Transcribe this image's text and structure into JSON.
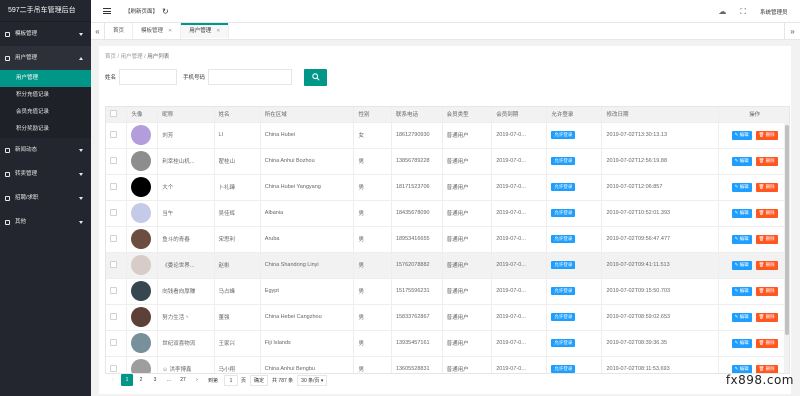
{
  "app": {
    "title": "597二手吊车管理后台",
    "refresh_label": "【刷新页面】",
    "system_label": "系统管理员"
  },
  "sidebar": {
    "groups": [
      {
        "label": "模板管理",
        "open": false,
        "items": []
      },
      {
        "label": "用户管理",
        "open": true,
        "items": [
          {
            "label": "用户管理",
            "active": true
          },
          {
            "label": "积分充值记录",
            "active": false
          },
          {
            "label": "会员充值记录",
            "active": false
          },
          {
            "label": "积分奖励记录",
            "active": false
          }
        ]
      },
      {
        "label": "新闻动态",
        "open": false,
        "items": []
      },
      {
        "label": "转卖管理",
        "open": false,
        "items": []
      },
      {
        "label": "招聘/求职",
        "open": false,
        "items": []
      },
      {
        "label": "其他",
        "open": false,
        "items": []
      }
    ]
  },
  "tabs": [
    {
      "label": "首页",
      "active": false,
      "closable": false
    },
    {
      "label": "模板管理",
      "active": false,
      "closable": true
    },
    {
      "label": "用户管理",
      "active": true,
      "closable": true
    }
  ],
  "breadcrumb": [
    "首页",
    "用户管理",
    "用户列表"
  ],
  "search": {
    "name_label": "姓名",
    "name_value": "",
    "phone_label": "手机号码",
    "phone_value": ""
  },
  "table": {
    "columns": [
      "头像",
      "昵称",
      "姓名",
      "所在区域",
      "性别",
      "联系电话",
      "会员类型",
      "会员到期",
      "允许登录",
      "修改日期",
      "操作"
    ],
    "rows": [
      {
        "avatar": "#b39ddb",
        "nickname": "刘芳",
        "name": "LI",
        "region": "China Hubei",
        "gender": "女",
        "phone": "18612790930",
        "type": "普通用户",
        "expiry": "2019-07-0...",
        "login": "允许登录",
        "modified": "2019-07-02T13:30:13.13",
        "highlight": false
      },
      {
        "avatar": "#8d8d8d",
        "nickname": "利幸桂山机...",
        "name": "翟桂山",
        "region": "China Anhui Bozhou",
        "gender": "男",
        "phone": "13856789228",
        "type": "普通用户",
        "expiry": "2019-07-0...",
        "login": "允许登录",
        "modified": "2019-07-02T12:56:19.88",
        "highlight": false
      },
      {
        "avatar": "#000000",
        "nickname": "大个",
        "name": "卜礼臻",
        "region": "China Hubei Yangyang",
        "gender": "男",
        "phone": "18171523706",
        "type": "普通用户",
        "expiry": "2019-07-0...",
        "login": "允许登录",
        "modified": "2019-07-02T12:06:857",
        "highlight": false
      },
      {
        "avatar": "#c5cae9",
        "nickname": "当午",
        "name": "吴佳辉",
        "region": "Albania",
        "gender": "男",
        "phone": "18435678090",
        "type": "普通用户",
        "expiry": "2019-07-0...",
        "login": "允许登录",
        "modified": "2019-07-02T10:52:01.393",
        "highlight": false
      },
      {
        "avatar": "#6d4c41",
        "nickname": "鱼斗的青春",
        "name": "宋思利",
        "region": "Aruba",
        "gender": "男",
        "phone": "18953416655",
        "type": "普通用户",
        "expiry": "2019-07-0...",
        "login": "允许登录",
        "modified": "2019-07-02T09:56:47.477",
        "highlight": false
      },
      {
        "avatar": "#d7ccc8",
        "nickname": "《委论世界...",
        "name": "赵彬",
        "region": "China Shandong Linyi",
        "gender": "男",
        "phone": "15762078882",
        "type": "普通用户",
        "expiry": "2019-07-0...",
        "login": "允许登录",
        "modified": "2019-07-02T09:41:11.513",
        "highlight": true
      },
      {
        "avatar": "#37474f",
        "nickname": "向钱看向厚赚",
        "name": "马占峰",
        "region": "Egypt",
        "gender": "男",
        "phone": "15175596231",
        "type": "普通用户",
        "expiry": "2019-07-0...",
        "login": "允许登录",
        "modified": "2019-07-02T09:15:50.703",
        "highlight": false
      },
      {
        "avatar": "#5d4037",
        "nickname": "努力生活丶",
        "name": "董强",
        "region": "China Hebei Cangzhou",
        "gender": "男",
        "phone": "15833762867",
        "type": "普通用户",
        "expiry": "2019-07-0...",
        "login": "允许登录",
        "modified": "2019-07-02T08:59:02.653",
        "highlight": false
      },
      {
        "avatar": "#78909c",
        "nickname": "世纪双喜物流",
        "name": "王家兴",
        "region": "Fiji Islands",
        "gender": "男",
        "phone": "13935457161",
        "type": "普通用户",
        "expiry": "2019-07-0...",
        "login": "允许登录",
        "modified": "2019-07-02T08:39:36.35",
        "highlight": false
      },
      {
        "avatar": "#9e9e9e",
        "nickname": "☺ 洪李博鑫",
        "name": "马小翔",
        "region": "China Anhui Bengbu",
        "gender": "男",
        "phone": "13605528831",
        "type": "普通用户",
        "expiry": "2019-07-0...",
        "login": "允许登录",
        "modified": "2019-07-02T08:11:53.693",
        "highlight": false
      }
    ],
    "edit_label": "✎ 编辑",
    "delete_label": "🗑 删除"
  },
  "pagination": {
    "pages": [
      "1",
      "2",
      "3",
      "...",
      "27"
    ],
    "current": "1",
    "goto_label": "到第",
    "goto_value": "1",
    "page_unit": "页",
    "confirm_label": "确定",
    "total_label": "共 787 条",
    "page_size": "30 条/页 ▾"
  },
  "watermark": "fx898.com"
}
